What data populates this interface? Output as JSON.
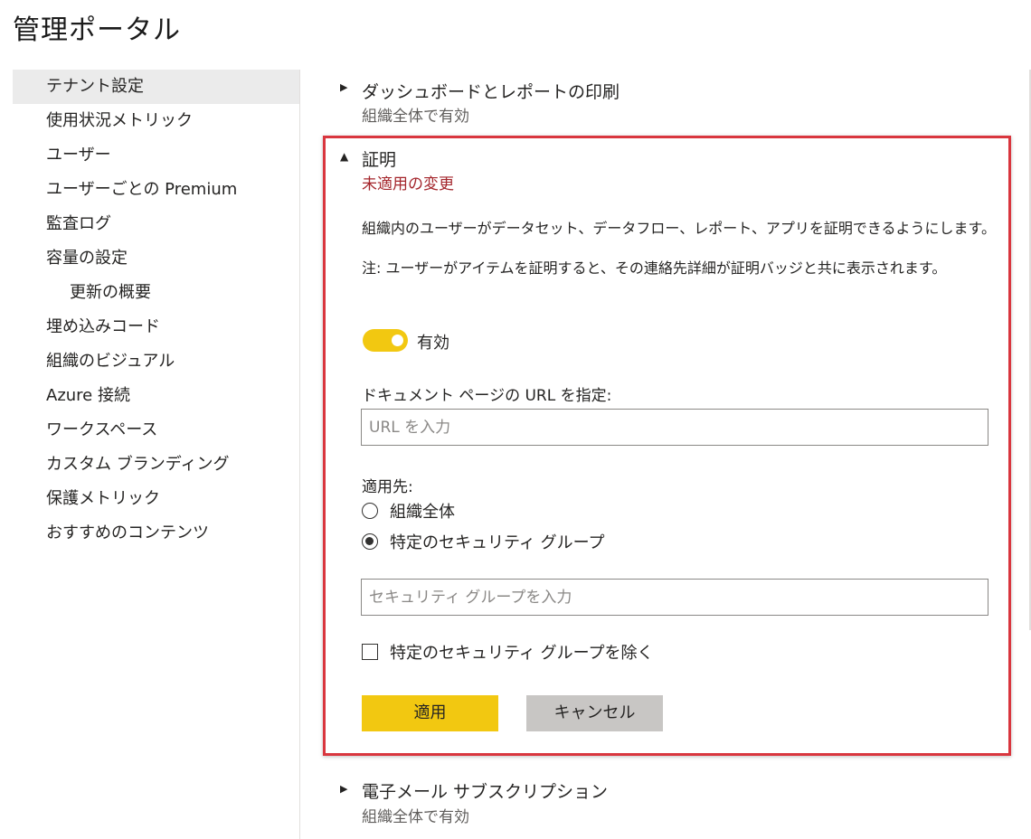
{
  "page_title": "管理ポータル",
  "sidebar": {
    "items": [
      {
        "label": "テナント設定",
        "active": true
      },
      {
        "label": "使用状況メトリック"
      },
      {
        "label": "ユーザー"
      },
      {
        "label": "ユーザーごとの Premium"
      },
      {
        "label": "監査ログ"
      },
      {
        "label": "容量の設定"
      },
      {
        "label": "更新の概要",
        "indent": true
      },
      {
        "label": "埋め込みコード"
      },
      {
        "label": "組織のビジュアル"
      },
      {
        "label": "Azure 接続"
      },
      {
        "label": "ワークスペース"
      },
      {
        "label": "カスタム ブランディング"
      },
      {
        "label": "保護メトリック"
      },
      {
        "label": "おすすめのコンテンツ"
      }
    ]
  },
  "sections": {
    "print": {
      "title": "ダッシュボードとレポートの印刷",
      "status": "組織全体で有効",
      "expander_icon": "triangle-right"
    },
    "certification": {
      "title": "証明",
      "status": "未適用の変更",
      "status_color": "#a4262c",
      "expander_icon": "triangle-down",
      "description": "組織内のユーザーがデータセット、データフロー、レポート、アプリを証明できるようにします。",
      "note": "注: ユーザーがアイテムを証明すると、その連絡先詳細が証明バッジと共に表示されます。",
      "toggle": {
        "label": "有効",
        "on": true
      },
      "url_field": {
        "label": "ドキュメント ページの URL を指定:",
        "placeholder": "URL を入力",
        "value": ""
      },
      "apply_to": {
        "label": "適用先:",
        "options": [
          {
            "label": "組織全体",
            "checked": false
          },
          {
            "label": "特定のセキュリティ グループ",
            "checked": true
          }
        ]
      },
      "security_group_field": {
        "placeholder": "セキュリティ グループを入力",
        "value": ""
      },
      "exclude_checkbox": {
        "label": "特定のセキュリティ グループを除く",
        "checked": false
      },
      "apply_button": "適用",
      "cancel_button": "キャンセル"
    },
    "email": {
      "title": "電子メール サブスクリプション",
      "status": "組織全体で有効",
      "expander_icon": "triangle-right"
    }
  },
  "colors": {
    "accent": "#f2c811",
    "highlight_border": "#d9363e",
    "cancel_button": "#c8c6c4",
    "active_nav": "#ebebeb"
  }
}
